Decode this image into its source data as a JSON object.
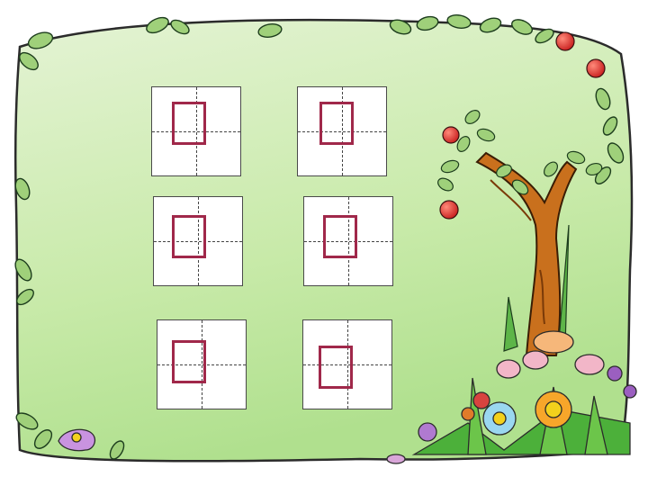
{
  "slide": {
    "background_color": "#ffffff",
    "panel_colors": [
      "#dcefc6",
      "#b7e49a"
    ],
    "marker_color": "#a0284a",
    "grid_line_color": "#444444"
  },
  "practice_boxes": [
    {
      "id": 1,
      "marker": "red-square"
    },
    {
      "id": 2,
      "marker": "red-square"
    },
    {
      "id": 3,
      "marker": "red-square"
    },
    {
      "id": 4,
      "marker": "red-square"
    },
    {
      "id": 5,
      "marker": "red-square"
    },
    {
      "id": 6,
      "marker": "red-square"
    }
  ],
  "decorations": {
    "border": "leaf-vine-icon",
    "tree": "apple-tree-icon",
    "flowers": "flower-bouquet-icon"
  }
}
